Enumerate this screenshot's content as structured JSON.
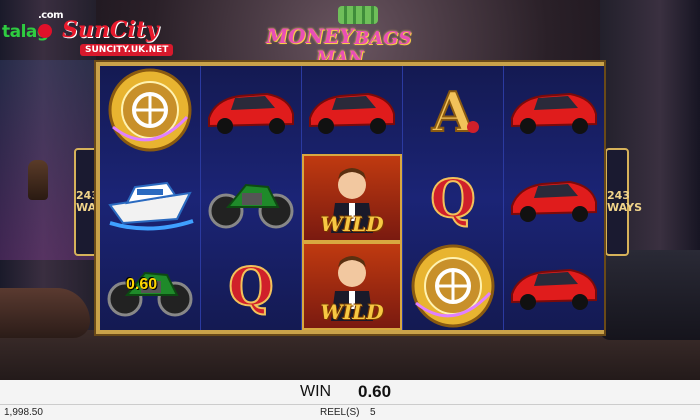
{
  "logo": {
    "left_text": "talag",
    "com": ".com",
    "brand": "SunCity",
    "url": "SUNCITY.UK.NET"
  },
  "title": {
    "word1": "MONEY",
    "word2": "BAGS",
    "word3": "MAN"
  },
  "ways": {
    "number": "243",
    "label": "WAYS"
  },
  "reels": [
    [
      "coin-vault",
      "yacht",
      "motorcycle"
    ],
    [
      "red-car",
      "motorcycle",
      "Q"
    ],
    [
      "red-car",
      "wild-man",
      "wild-man"
    ],
    [
      "A",
      "Q",
      "coin-vault"
    ],
    [
      "red-car",
      "red-car",
      "red-car"
    ]
  ],
  "wild_label": "WILD",
  "symbol_win": "0.60",
  "bottom_bar": {
    "win_label": "WIN",
    "win_value": "0.60",
    "balance": "1,998.50",
    "reels_label": "REEL(S)",
    "reels_value": "5"
  },
  "colors": {
    "frame_gold": "#c9a24a",
    "reel_blue": "#1b2476",
    "title_pink": "#e94fb6",
    "car_red": "#e01c1c"
  }
}
